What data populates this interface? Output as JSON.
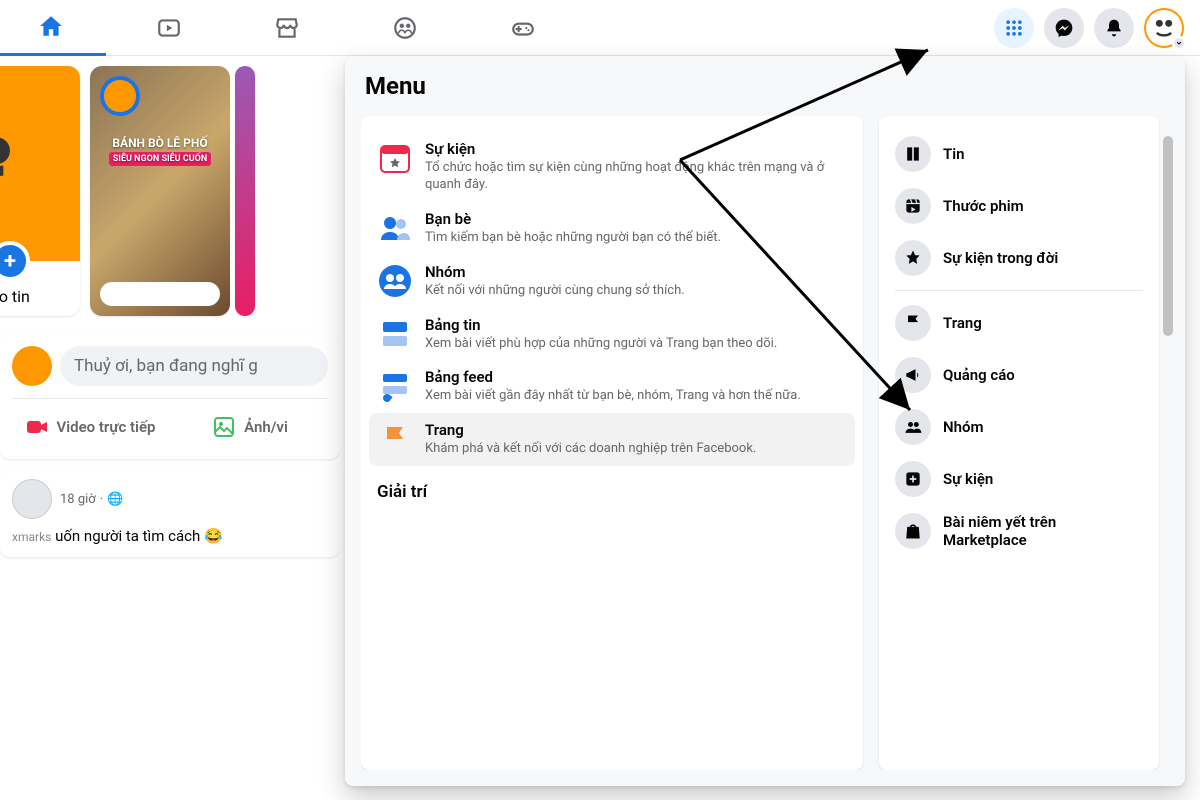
{
  "topnav": {
    "tabs": [
      "home",
      "watch",
      "marketplace",
      "groups",
      "gaming"
    ]
  },
  "stories": {
    "create_label": "ạo tin",
    "story2_overlay_top": "BÁNH BÒ LÊ PHỐ",
    "story2_overlay_sub": "SIÊU NGON SIÊU CUỐN"
  },
  "composer": {
    "placeholder": "Thuỷ ơi, bạn đang nghĩ g",
    "live_label": "Video trực tiếp",
    "photo_label": "Ảnh/vi"
  },
  "post": {
    "time": "18 giờ",
    "visibility": "🌐",
    "text_fragment": "uốn người ta tìm cách 😂",
    "xmarks": "xmarks"
  },
  "menu": {
    "title": "Menu",
    "left_items": [
      {
        "icon": "calendar-star",
        "label": "Sự kiện",
        "desc": "Tổ chức hoặc tìm sự kiện cùng những hoạt động khác trên mạng và ở quanh đây."
      },
      {
        "icon": "friends",
        "label": "Bạn bè",
        "desc": "Tìm kiếm bạn bè hoặc những người bạn có thể biết."
      },
      {
        "icon": "groups",
        "label": "Nhóm",
        "desc": "Kết nối với những người cùng chung sở thích."
      },
      {
        "icon": "newsfeed",
        "label": "Bảng tin",
        "desc": "Xem bài viết phù hợp của những người và Trang bạn theo dõi."
      },
      {
        "icon": "feeds",
        "label": "Bảng feed",
        "desc": "Xem bài viết gần đây nhất từ bạn bè, nhóm, Trang và hơn thế nữa."
      },
      {
        "icon": "pages",
        "label": "Trang",
        "desc": "Khám phá và kết nối với các doanh nghiệp trên Facebook.",
        "highlight": true
      }
    ],
    "section": "Giải trí",
    "right_items": [
      {
        "icon": "book",
        "label": "Tin"
      },
      {
        "icon": "reel",
        "label": "Thước phim"
      },
      {
        "icon": "star",
        "label": "Sự kiện trong đời"
      },
      {
        "divider": true
      },
      {
        "icon": "flag",
        "label": "Trang"
      },
      {
        "icon": "megaphone",
        "label": "Quảng cáo"
      },
      {
        "icon": "group",
        "label": "Nhóm"
      },
      {
        "icon": "plus-square",
        "label": "Sự kiện"
      },
      {
        "icon": "bag",
        "label": "Bài niêm yết trên Marketplace"
      }
    ]
  }
}
